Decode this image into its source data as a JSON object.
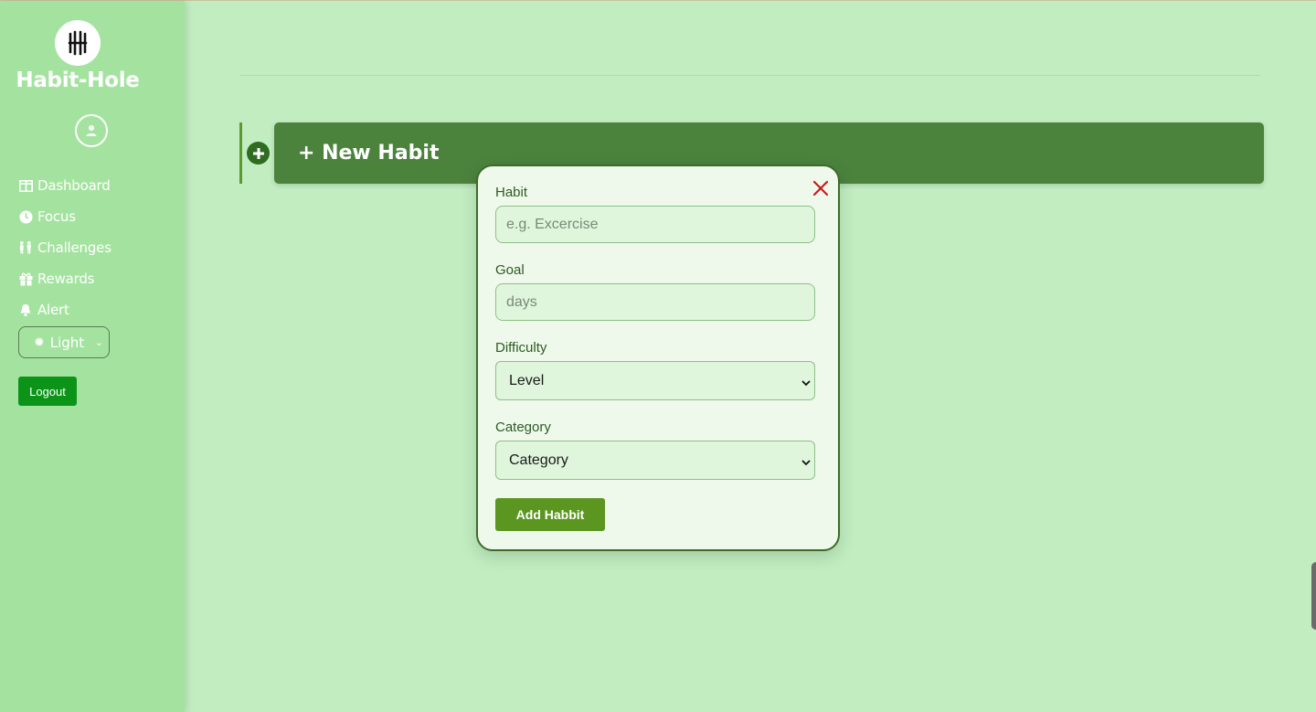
{
  "sidebar": {
    "brand": "Habit-Hole",
    "logo_icon": "habit-hole-logo",
    "avatar_icon": "user-icon",
    "items": [
      {
        "label": "Dashboard",
        "icon": "dashboard-icon"
      },
      {
        "label": "Focus",
        "icon": "clock-icon"
      },
      {
        "label": "Challenges",
        "icon": "people-icon"
      },
      {
        "label": "Rewards",
        "icon": "gift-icon"
      },
      {
        "label": "Alert",
        "icon": "bell-icon"
      }
    ],
    "theme": {
      "selected": "Light",
      "icon": "sun-icon"
    },
    "logout_label": "Logout"
  },
  "main": {
    "new_habit_label": "+ New Habit"
  },
  "modal": {
    "habit_label": "Habit",
    "habit_placeholder": "e.g. Excercise",
    "goal_label": "Goal",
    "goal_placeholder": "days",
    "difficulty_label": "Difficulty",
    "difficulty_selected": "Level",
    "category_label": "Category",
    "category_selected": "Category",
    "submit_label": "Add Habbit"
  },
  "colors": {
    "page_bg": "#c1edc0",
    "sidebar_bg": "#a4e39f",
    "banner_bg": "#4b833d",
    "modal_bg": "#eef9ec",
    "logout_bg": "#0c9418",
    "submit_bg": "#5a9620",
    "close_icon": "#cc1a1a"
  }
}
